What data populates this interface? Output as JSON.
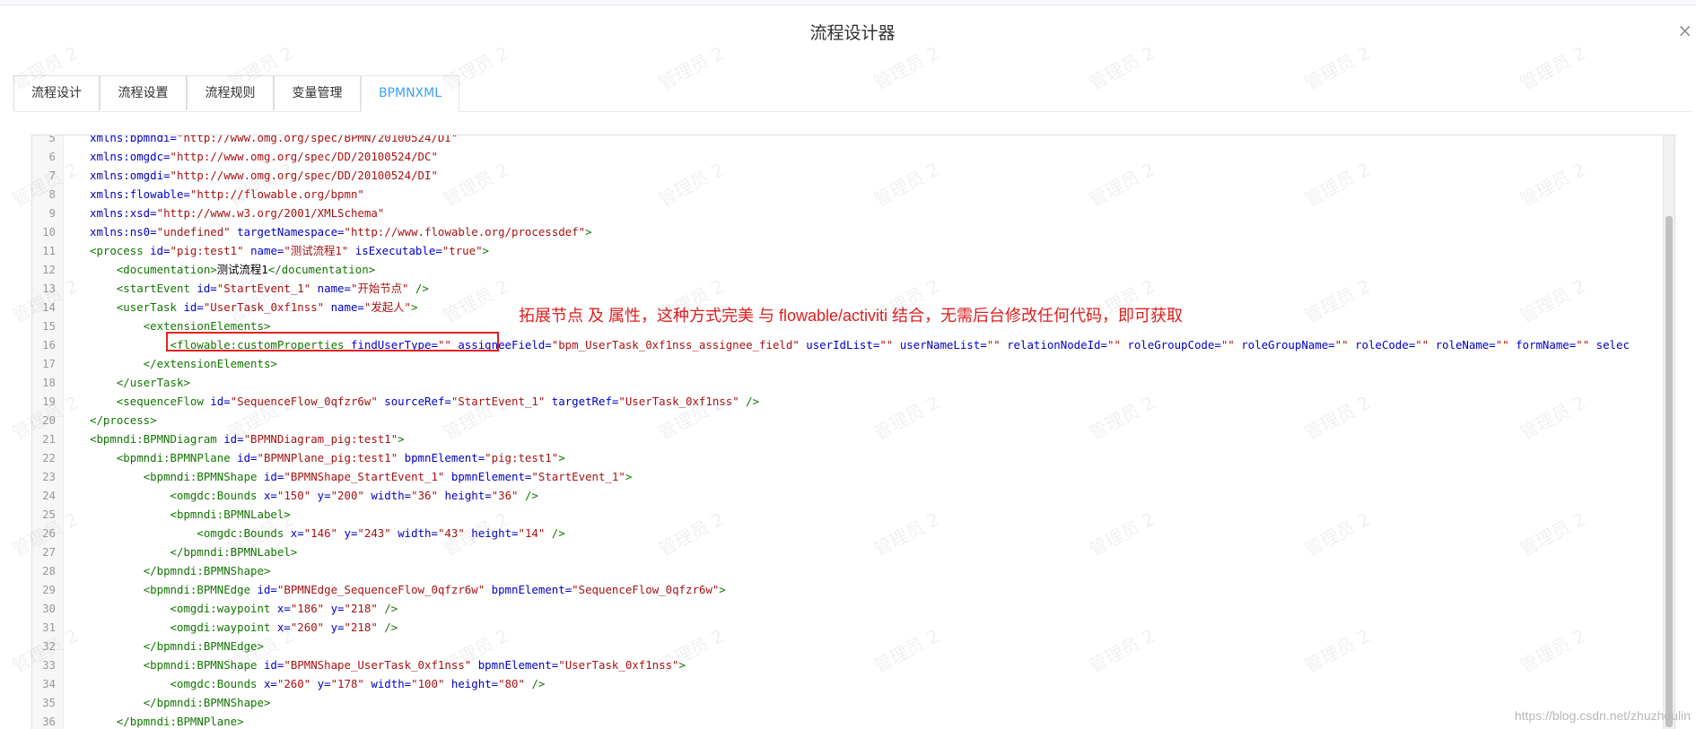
{
  "dialog": {
    "title": "流程设计器",
    "close_symbol": "×"
  },
  "tabs": [
    {
      "label": "流程设计",
      "active": false
    },
    {
      "label": "流程设置",
      "active": false
    },
    {
      "label": "流程规则",
      "active": false
    },
    {
      "label": "变量管理",
      "active": false
    },
    {
      "label": "BPMNXML",
      "active": true
    }
  ],
  "editor": {
    "lines": [
      {
        "n": "5",
        "parts": [
          [
            "attr",
            "xmlns:bpmndi="
          ],
          [
            "val",
            "\"http://www.omg.org/spec/BPMN/20100524/DI\""
          ]
        ]
      },
      {
        "n": "6",
        "parts": [
          [
            "attr",
            "xmlns:omgdc="
          ],
          [
            "val",
            "\"http://www.omg.org/spec/DD/20100524/DC\""
          ]
        ]
      },
      {
        "n": "7",
        "parts": [
          [
            "attr",
            "xmlns:omgdi="
          ],
          [
            "val",
            "\"http://www.omg.org/spec/DD/20100524/DI\""
          ]
        ]
      },
      {
        "n": "8",
        "parts": [
          [
            "attr",
            "xmlns:flowable="
          ],
          [
            "val",
            "\"http://flowable.org/bpmn\""
          ]
        ]
      },
      {
        "n": "9",
        "parts": [
          [
            "attr",
            "xmlns:xsd="
          ],
          [
            "val",
            "\"http://www.w3.org/2001/XMLSchema\""
          ]
        ]
      },
      {
        "n": "10",
        "parts": [
          [
            "attr",
            "xmlns:ns0="
          ],
          [
            "val",
            "\"undefined\""
          ],
          [
            "text",
            " "
          ],
          [
            "attr",
            "targetNamespace="
          ],
          [
            "val",
            "\"http://www.flowable.org/processdef\""
          ],
          [
            "tag",
            ">"
          ]
        ]
      },
      {
        "n": "11",
        "parts": [
          [
            "tag",
            "<process "
          ],
          [
            "attr",
            "id="
          ],
          [
            "val",
            "\"pig:test1\""
          ],
          [
            "text",
            " "
          ],
          [
            "attr",
            "name="
          ],
          [
            "val",
            "\"测试流程1\""
          ],
          [
            "text",
            " "
          ],
          [
            "attr",
            "isExecutable="
          ],
          [
            "val",
            "\"true\""
          ],
          [
            "tag",
            ">"
          ]
        ]
      },
      {
        "n": "12",
        "parts": [
          [
            "text",
            "    "
          ],
          [
            "tag",
            "<documentation>"
          ],
          [
            "text",
            "测试流程1"
          ],
          [
            "tag",
            "</documentation>"
          ]
        ]
      },
      {
        "n": "13",
        "parts": [
          [
            "text",
            "    "
          ],
          [
            "tag",
            "<startEvent "
          ],
          [
            "attr",
            "id="
          ],
          [
            "val",
            "\"StartEvent_1\""
          ],
          [
            "text",
            " "
          ],
          [
            "attr",
            "name="
          ],
          [
            "val",
            "\"开始节点\""
          ],
          [
            "tag",
            " />"
          ]
        ]
      },
      {
        "n": "14",
        "parts": [
          [
            "text",
            "    "
          ],
          [
            "tag",
            "<userTask "
          ],
          [
            "attr",
            "id="
          ],
          [
            "val",
            "\"UserTask_0xf1nss\""
          ],
          [
            "text",
            " "
          ],
          [
            "attr",
            "name="
          ],
          [
            "val",
            "\"发起人\""
          ],
          [
            "tag",
            ">"
          ]
        ]
      },
      {
        "n": "15",
        "parts": [
          [
            "text",
            "        "
          ],
          [
            "tag",
            "<extensionElements>"
          ]
        ]
      },
      {
        "n": "16",
        "parts": [
          [
            "text",
            "            "
          ],
          [
            "tag",
            "<flowable:customProperties "
          ],
          [
            "attr",
            "findUserType="
          ],
          [
            "val",
            "\"\""
          ],
          [
            "text",
            " "
          ],
          [
            "attr",
            "assigneeField="
          ],
          [
            "val",
            "\"bpm_UserTask_0xf1nss_assignee_field\""
          ],
          [
            "text",
            " "
          ],
          [
            "attr",
            "userIdList="
          ],
          [
            "val",
            "\"\""
          ],
          [
            "text",
            " "
          ],
          [
            "attr",
            "userNameList="
          ],
          [
            "val",
            "\"\""
          ],
          [
            "text",
            " "
          ],
          [
            "attr",
            "relationNodeId="
          ],
          [
            "val",
            "\"\""
          ],
          [
            "text",
            " "
          ],
          [
            "attr",
            "roleGroupCode="
          ],
          [
            "val",
            "\"\""
          ],
          [
            "text",
            " "
          ],
          [
            "attr",
            "roleGroupName="
          ],
          [
            "val",
            "\"\""
          ],
          [
            "text",
            " "
          ],
          [
            "attr",
            "roleCode="
          ],
          [
            "val",
            "\"\""
          ],
          [
            "text",
            " "
          ],
          [
            "attr",
            "roleName="
          ],
          [
            "val",
            "\"\""
          ],
          [
            "text",
            " "
          ],
          [
            "attr",
            "formName="
          ],
          [
            "val",
            "\"\""
          ],
          [
            "text",
            " "
          ],
          [
            "attr",
            "selec"
          ]
        ]
      },
      {
        "n": "17",
        "parts": [
          [
            "text",
            "        "
          ],
          [
            "tag",
            "</extensionElements>"
          ]
        ]
      },
      {
        "n": "18",
        "parts": [
          [
            "text",
            "    "
          ],
          [
            "tag",
            "</userTask>"
          ]
        ]
      },
      {
        "n": "19",
        "parts": [
          [
            "text",
            "    "
          ],
          [
            "tag",
            "<sequenceFlow "
          ],
          [
            "attr",
            "id="
          ],
          [
            "val",
            "\"SequenceFlow_0qfzr6w\""
          ],
          [
            "text",
            " "
          ],
          [
            "attr",
            "sourceRef="
          ],
          [
            "val",
            "\"StartEvent_1\""
          ],
          [
            "text",
            " "
          ],
          [
            "attr",
            "targetRef="
          ],
          [
            "val",
            "\"UserTask_0xf1nss\""
          ],
          [
            "tag",
            " />"
          ]
        ]
      },
      {
        "n": "20",
        "parts": [
          [
            "tag",
            "</process>"
          ]
        ]
      },
      {
        "n": "21",
        "parts": [
          [
            "tag",
            "<bpmndi:BPMNDiagram "
          ],
          [
            "attr",
            "id="
          ],
          [
            "val",
            "\"BPMNDiagram_pig:test1\""
          ],
          [
            "tag",
            ">"
          ]
        ]
      },
      {
        "n": "22",
        "parts": [
          [
            "text",
            "    "
          ],
          [
            "tag",
            "<bpmndi:BPMNPlane "
          ],
          [
            "attr",
            "id="
          ],
          [
            "val",
            "\"BPMNPlane_pig:test1\""
          ],
          [
            "text",
            " "
          ],
          [
            "attr",
            "bpmnElement="
          ],
          [
            "val",
            "\"pig:test1\""
          ],
          [
            "tag",
            ">"
          ]
        ]
      },
      {
        "n": "23",
        "parts": [
          [
            "text",
            "        "
          ],
          [
            "tag",
            "<bpmndi:BPMNShape "
          ],
          [
            "attr",
            "id="
          ],
          [
            "val",
            "\"BPMNShape_StartEvent_1\""
          ],
          [
            "text",
            " "
          ],
          [
            "attr",
            "bpmnElement="
          ],
          [
            "val",
            "\"StartEvent_1\""
          ],
          [
            "tag",
            ">"
          ]
        ]
      },
      {
        "n": "24",
        "parts": [
          [
            "text",
            "            "
          ],
          [
            "tag",
            "<omgdc:Bounds "
          ],
          [
            "attr",
            "x="
          ],
          [
            "val",
            "\"150\""
          ],
          [
            "text",
            " "
          ],
          [
            "attr",
            "y="
          ],
          [
            "val",
            "\"200\""
          ],
          [
            "text",
            " "
          ],
          [
            "attr",
            "width="
          ],
          [
            "val",
            "\"36\""
          ],
          [
            "text",
            " "
          ],
          [
            "attr",
            "height="
          ],
          [
            "val",
            "\"36\""
          ],
          [
            "tag",
            " />"
          ]
        ]
      },
      {
        "n": "25",
        "parts": [
          [
            "text",
            "            "
          ],
          [
            "tag",
            "<bpmndi:BPMNLabel>"
          ]
        ]
      },
      {
        "n": "26",
        "parts": [
          [
            "text",
            "                "
          ],
          [
            "tag",
            "<omgdc:Bounds "
          ],
          [
            "attr",
            "x="
          ],
          [
            "val",
            "\"146\""
          ],
          [
            "text",
            " "
          ],
          [
            "attr",
            "y="
          ],
          [
            "val",
            "\"243\""
          ],
          [
            "text",
            " "
          ],
          [
            "attr",
            "width="
          ],
          [
            "val",
            "\"43\""
          ],
          [
            "text",
            " "
          ],
          [
            "attr",
            "height="
          ],
          [
            "val",
            "\"14\""
          ],
          [
            "tag",
            " />"
          ]
        ]
      },
      {
        "n": "27",
        "parts": [
          [
            "text",
            "            "
          ],
          [
            "tag",
            "</bpmndi:BPMNLabel>"
          ]
        ]
      },
      {
        "n": "28",
        "parts": [
          [
            "text",
            "        "
          ],
          [
            "tag",
            "</bpmndi:BPMNShape>"
          ]
        ]
      },
      {
        "n": "29",
        "parts": [
          [
            "text",
            "        "
          ],
          [
            "tag",
            "<bpmndi:BPMNEdge "
          ],
          [
            "attr",
            "id="
          ],
          [
            "val",
            "\"BPMNEdge_SequenceFlow_0qfzr6w\""
          ],
          [
            "text",
            " "
          ],
          [
            "attr",
            "bpmnElement="
          ],
          [
            "val",
            "\"SequenceFlow_0qfzr6w\""
          ],
          [
            "tag",
            ">"
          ]
        ]
      },
      {
        "n": "30",
        "parts": [
          [
            "text",
            "            "
          ],
          [
            "tag",
            "<omgdi:waypoint "
          ],
          [
            "attr",
            "x="
          ],
          [
            "val",
            "\"186\""
          ],
          [
            "text",
            " "
          ],
          [
            "attr",
            "y="
          ],
          [
            "val",
            "\"218\""
          ],
          [
            "tag",
            " />"
          ]
        ]
      },
      {
        "n": "31",
        "parts": [
          [
            "text",
            "            "
          ],
          [
            "tag",
            "<omgdi:waypoint "
          ],
          [
            "attr",
            "x="
          ],
          [
            "val",
            "\"260\""
          ],
          [
            "text",
            " "
          ],
          [
            "attr",
            "y="
          ],
          [
            "val",
            "\"218\""
          ],
          [
            "tag",
            " />"
          ]
        ]
      },
      {
        "n": "32",
        "parts": [
          [
            "text",
            "        "
          ],
          [
            "tag",
            "</bpmndi:BPMNEdge>"
          ]
        ]
      },
      {
        "n": "33",
        "parts": [
          [
            "text",
            "        "
          ],
          [
            "tag",
            "<bpmndi:BPMNShape "
          ],
          [
            "attr",
            "id="
          ],
          [
            "val",
            "\"BPMNShape_UserTask_0xf1nss\""
          ],
          [
            "text",
            " "
          ],
          [
            "attr",
            "bpmnElement="
          ],
          [
            "val",
            "\"UserTask_0xf1nss\""
          ],
          [
            "tag",
            ">"
          ]
        ]
      },
      {
        "n": "34",
        "parts": [
          [
            "text",
            "            "
          ],
          [
            "tag",
            "<omgdc:Bounds "
          ],
          [
            "attr",
            "x="
          ],
          [
            "val",
            "\"260\""
          ],
          [
            "text",
            " "
          ],
          [
            "attr",
            "y="
          ],
          [
            "val",
            "\"178\""
          ],
          [
            "text",
            " "
          ],
          [
            "attr",
            "width="
          ],
          [
            "val",
            "\"100\""
          ],
          [
            "text",
            " "
          ],
          [
            "attr",
            "height="
          ],
          [
            "val",
            "\"80\""
          ],
          [
            "tag",
            " />"
          ]
        ]
      },
      {
        "n": "35",
        "parts": [
          [
            "text",
            "        "
          ],
          [
            "tag",
            "</bpmndi:BPMNShape>"
          ]
        ]
      },
      {
        "n": "36",
        "parts": [
          [
            "text",
            "    "
          ],
          [
            "tag",
            "</bpmndi:BPMNPlane>"
          ]
        ]
      }
    ]
  },
  "annotation": {
    "text": "拓展节点 及 属性，这种方式完美 与 flowable/activiti 结合，无需后台修改任何代码，即可获取"
  },
  "watermark": {
    "text": "管理员 2"
  },
  "footer": {
    "credit": "https://blog.csdn.net/zhuzhoulin"
  },
  "colors": {
    "tag": "#117700",
    "attr": "#0000cc",
    "value": "#aa1111",
    "active_tab": "#409eff",
    "annotation": "#e11d1d"
  }
}
